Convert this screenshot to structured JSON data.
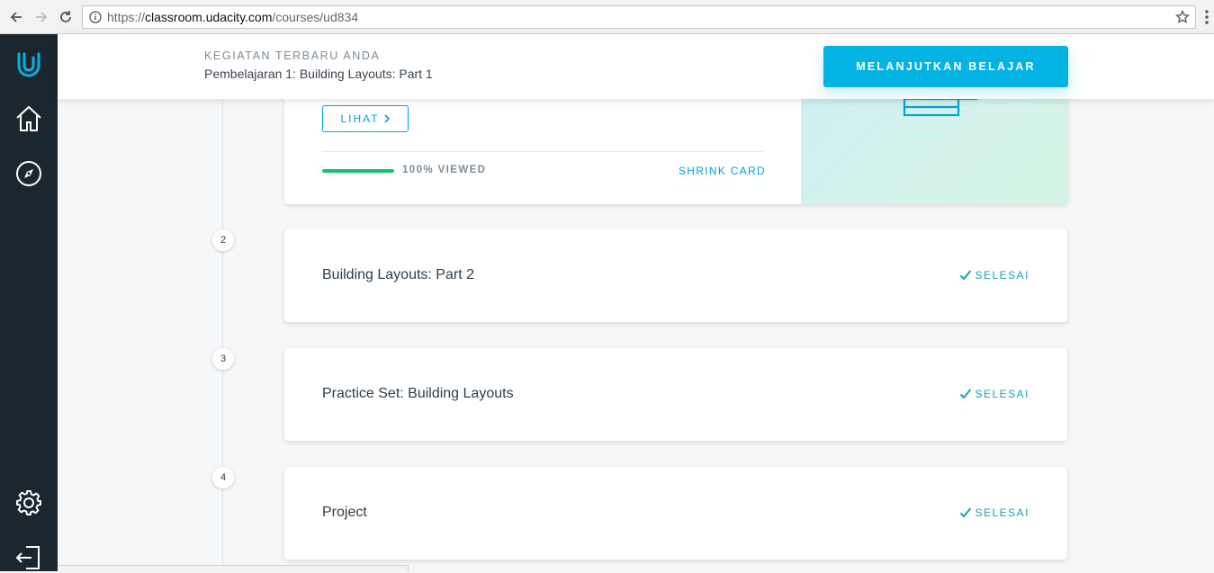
{
  "browser": {
    "url_protocol": "https://",
    "url_host": "classroom.udacity.com",
    "url_path": "/courses/ud834"
  },
  "banner": {
    "kicker": "KEGIATAN TERBARU ANDA",
    "lesson": "Pembelajaran 1: Building Layouts: Part 1",
    "continue_label": "MELANJUTKAN BELAJAR"
  },
  "expanded_card": {
    "view_label": "LIHAT",
    "progress": 1.0,
    "progress_label": "100% VIEWED",
    "shrink_label": "SHRINK CARD"
  },
  "lessons": [
    {
      "number": "2",
      "title": "Building Layouts: Part 2",
      "status": "SELESAI"
    },
    {
      "number": "3",
      "title": "Practice Set: Building Layouts",
      "status": "SELESAI"
    },
    {
      "number": "4",
      "title": "Project",
      "status": "SELESAI"
    }
  ],
  "colors": {
    "accent": "#02b3e4",
    "rail": "#1c262f",
    "success": "#15c26b",
    "complete": "#15a4b3"
  },
  "rail_icons": [
    "udacity-logo-icon",
    "home-icon",
    "compass-icon",
    "gear-icon",
    "logout-icon"
  ]
}
